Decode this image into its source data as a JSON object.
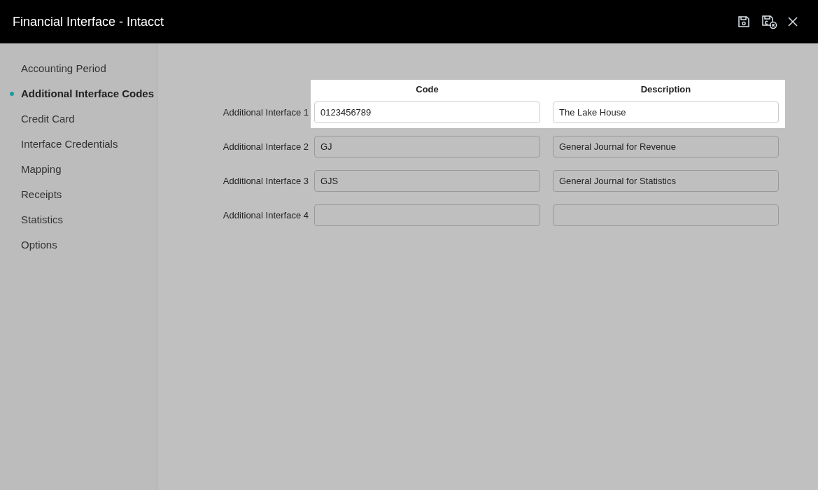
{
  "window": {
    "title": "Financial Interface - Intacct"
  },
  "sidebar": {
    "items": [
      {
        "label": "Accounting Period",
        "selected": false
      },
      {
        "label": "Additional Interface Codes",
        "selected": true
      },
      {
        "label": "Credit Card",
        "selected": false
      },
      {
        "label": "Interface Credentials",
        "selected": false
      },
      {
        "label": "Mapping",
        "selected": false
      },
      {
        "label": "Receipts",
        "selected": false
      },
      {
        "label": "Statistics",
        "selected": false
      },
      {
        "label": "Options",
        "selected": false
      }
    ]
  },
  "table": {
    "columns": [
      "Code",
      "Description"
    ],
    "rows": [
      {
        "label": "Additional Interface 1",
        "code": "0123456789",
        "description": "The Lake House",
        "highlighted": true
      },
      {
        "label": "Additional Interface 2",
        "code": "GJ",
        "description": "General Journal for Revenue",
        "highlighted": false
      },
      {
        "label": "Additional Interface 3",
        "code": "GJS",
        "description": "General Journal for Statistics",
        "highlighted": false
      },
      {
        "label": "Additional Interface 4",
        "code": "",
        "description": "",
        "highlighted": false
      }
    ]
  }
}
